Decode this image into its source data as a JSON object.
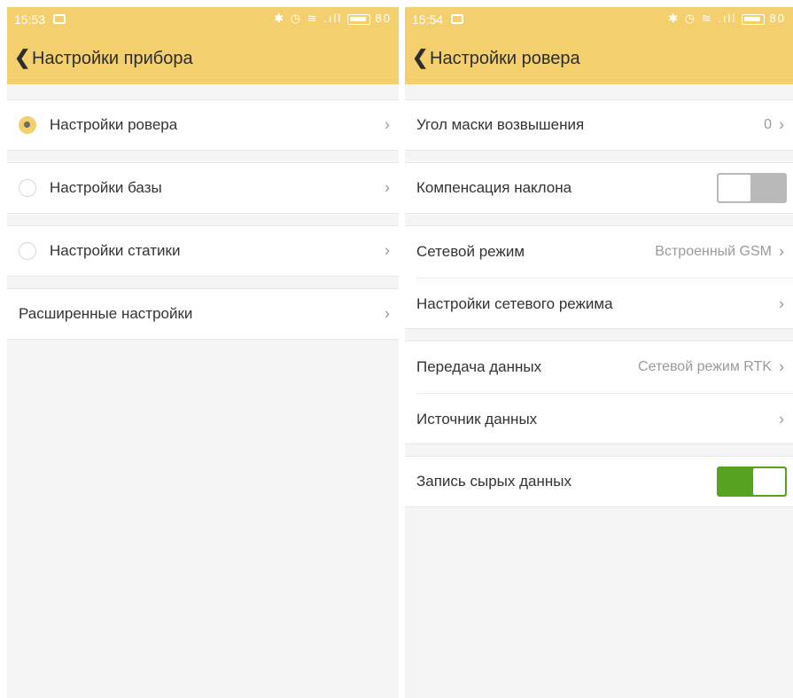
{
  "left": {
    "status": {
      "time": "15:53",
      "battery": "80"
    },
    "title": "Настройки прибора",
    "items": [
      {
        "label": "Настройки ровера"
      },
      {
        "label": "Настройки базы"
      },
      {
        "label": "Настройки статики"
      },
      {
        "label": "Расширенные настройки"
      }
    ],
    "selected_index": 0
  },
  "right": {
    "status": {
      "time": "15:54",
      "battery": "80"
    },
    "title": "Настройки ровера",
    "items": [
      {
        "label": "Угол маски возвышения",
        "value": "0"
      },
      {
        "label": "Компенсация наклона",
        "toggle": "off"
      },
      {
        "label": "Сетевой режим",
        "value": "Встроенный GSM"
      },
      {
        "label": "Настройки сетевого режима"
      },
      {
        "label": "Передача данных",
        "value": "Сетевой режим RTK"
      },
      {
        "label": "Источник данных"
      },
      {
        "label": "Запись сырых данных",
        "toggle": "on"
      }
    ]
  },
  "colors": {
    "accent": "#f3cf6e",
    "toggle_on": "#57a321",
    "toggle_off": "#b9b9b9",
    "background": "#f5f5f5"
  },
  "icons": {
    "back": "chevron-left-icon",
    "row": "chevron-right-icon",
    "status": [
      "image-icon",
      "bluetooth-icon",
      "alarm-icon",
      "wifi-icon",
      "signal-icon",
      "battery-icon"
    ]
  }
}
